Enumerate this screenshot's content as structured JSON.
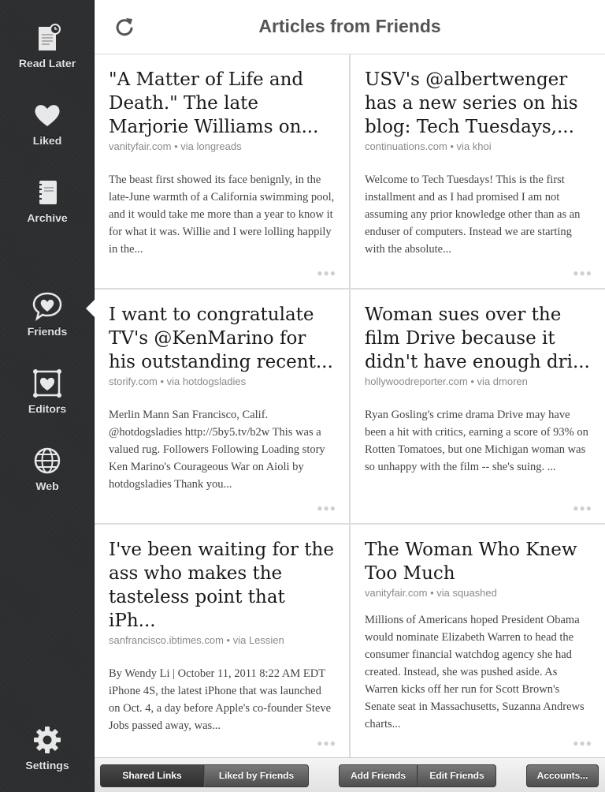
{
  "header": {
    "title": "Articles from Friends"
  },
  "sidebar": {
    "items": [
      {
        "label": "Read Later"
      },
      {
        "label": "Liked"
      },
      {
        "label": "Archive"
      },
      {
        "label": "Friends"
      },
      {
        "label": "Editors"
      },
      {
        "label": "Web"
      },
      {
        "label": "Settings"
      }
    ]
  },
  "articles": [
    {
      "title": "\"A Matter of Life and Death.\" The late Marjorie Williams on...",
      "meta": "vanityfair.com • via longreads",
      "excerpt": "The beast first showed its face benignly, in the late-June warmth of a California swimming pool, and it would take me more than a year to know it for what it was. Willie and I were lolling happily in the..."
    },
    {
      "title": "USV's @albertwenger has a new series on his blog: Tech Tuesdays,...",
      "meta": "continuations.com • via khoi",
      "excerpt": "Welcome to Tech Tuesdays! This is the first installment and as I had promised I am not assuming any prior knowledge other than as an enduser of computers. Instead we are starting with the absolute..."
    },
    {
      "title": "I want to congratulate TV's @KenMarino for his outstanding recent...",
      "meta": "storify.com • via hotdogsladies",
      "excerpt": "Merlin Mann San Francisco, Calif. @hotdogsladies http://5by5.tv/b2w This was a valued rug. Followers Following Loading story Ken Marino's Courageous War on Aioli by hotdogsladies Thank you..."
    },
    {
      "title": "Woman sues over the film Drive because it didn't have enough dri...",
      "meta": "hollywoodreporter.com • via dmoren",
      "excerpt": "Ryan Gosling's crime drama Drive may have been a hit with critics, earning a score of 93% on Rotten Tomatoes, but one Michigan woman was so unhappy with the film -- she's suing. ..."
    },
    {
      "title": "I've been waiting for the ass who makes the tasteless point that iPh...",
      "meta": "sanfrancisco.ibtimes.com • via Lessien",
      "excerpt_line1": "By Wendy Li | October 11, 2011 8:22 AM EDT",
      "excerpt": "iPhone 4S, the latest iPhone that was launched on Oct. 4, a day before Apple's co-founder Steve Jobs passed away, was..."
    },
    {
      "title": "The Woman Who Knew Too Much",
      "meta": "vanityfair.com • via squashed",
      "excerpt": "Millions of Americans hoped President Obama would nominate Elizabeth Warren to head the consumer financial watchdog agency she had created. Instead, she was pushed aside. As Warren kicks off her run for Scott Brown's Senate seat in Massachusetts, Suzanna Andrews charts..."
    }
  ],
  "card_more": "●●●",
  "toolbar": {
    "shared_links": "Shared Links",
    "liked_by_friends": "Liked by Friends",
    "add_friends": "Add Friends",
    "edit_friends": "Edit Friends",
    "accounts": "Accounts..."
  },
  "colors": {
    "sidebar_bg": "#2e2f31",
    "button_dark": "#4e4e4e",
    "title_gray": "#555555"
  }
}
